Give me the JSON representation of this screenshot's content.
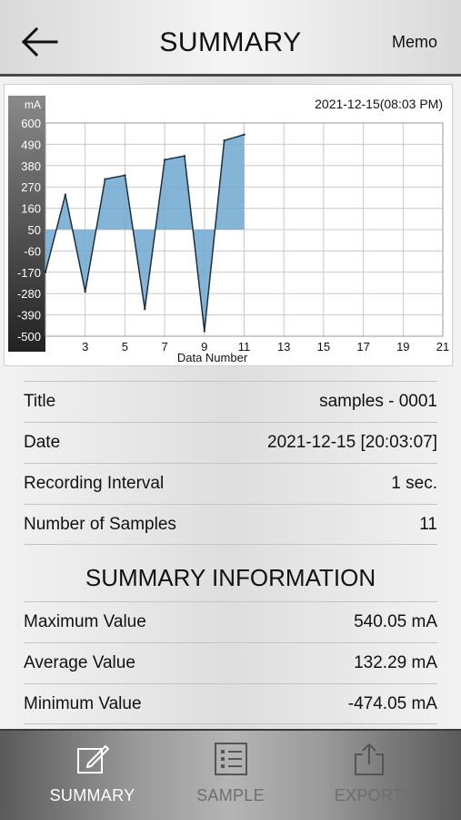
{
  "header": {
    "title": "SUMMARY",
    "memo_label": "Memo",
    "back_icon": "back-arrow-icon"
  },
  "chart_data": {
    "type": "area",
    "unit": "mA",
    "timestamp": "2021-12-15(08:03 PM)",
    "xlabel": "Data Number",
    "x_ticks": [
      "3",
      "5",
      "7",
      "9",
      "11",
      "13",
      "15",
      "17",
      "19",
      "21"
    ],
    "y_ticks": [
      "600",
      "490",
      "380",
      "270",
      "160",
      "50",
      "-60",
      "-170",
      "-280",
      "-390",
      "-500"
    ],
    "xlim": [
      1,
      21
    ],
    "ylim": [
      -500,
      600
    ],
    "baseline": 50,
    "x": [
      1,
      2,
      3,
      4,
      5,
      6,
      7,
      8,
      9,
      10,
      11
    ],
    "values": [
      -170,
      230,
      -270,
      310,
      330,
      -360,
      410,
      430,
      -474.05,
      510,
      540.05
    ],
    "colors": {
      "fill": "#6fa8d0",
      "line": "#1f2f3f",
      "axis_band": "#3a3a3a",
      "grid": "#c9c9c9"
    }
  },
  "details": [
    {
      "label": "Title",
      "value": "samples - 0001"
    },
    {
      "label": "Date",
      "value": "2021-12-15 [20:03:07]"
    },
    {
      "label": "Recording Interval",
      "value": "1 sec."
    },
    {
      "label": "Number of Samples",
      "value": "11"
    }
  ],
  "summary_info": {
    "title": "SUMMARY INFORMATION",
    "rows": [
      {
        "label": "Maximum Value",
        "value": "540.05 mA"
      },
      {
        "label": "Average Value",
        "value": "132.29 mA"
      },
      {
        "label": "Minimum Value",
        "value": "-474.05 mA"
      }
    ]
  },
  "tabs": [
    {
      "label": "SUMMARY",
      "icon": "edit-icon",
      "active": true
    },
    {
      "label": "SAMPLE",
      "icon": "list-icon",
      "active": false
    },
    {
      "label": "EXPORT",
      "icon": "share-icon",
      "active": false
    }
  ]
}
